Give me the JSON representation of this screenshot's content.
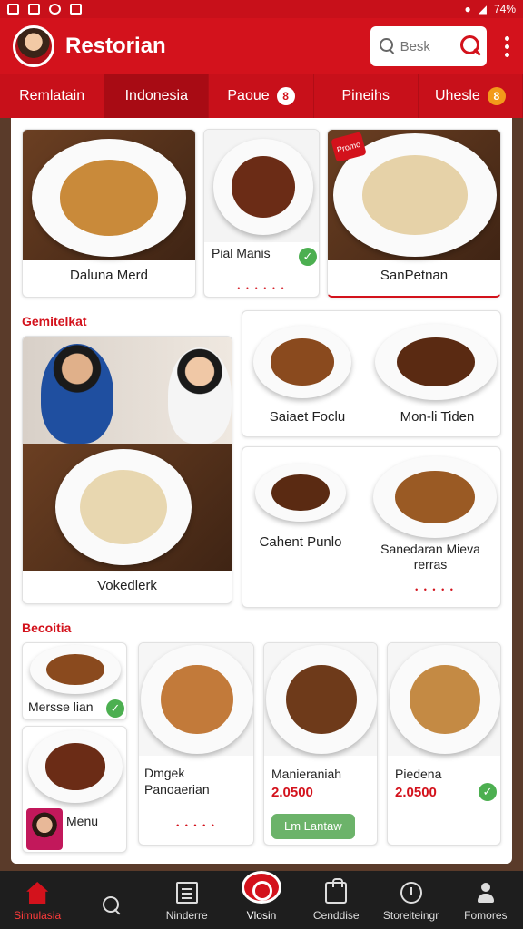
{
  "status_bar": {
    "battery": "74%"
  },
  "header": {
    "title": "Restorian",
    "search_placeholder": "Besk"
  },
  "tabs": [
    {
      "label": "Remlatain",
      "badge": ""
    },
    {
      "label": "Indonesia",
      "badge": ""
    },
    {
      "label": "Paoue",
      "badge": "8"
    },
    {
      "label": "Pineihs",
      "badge": ""
    },
    {
      "label": "Uhesle",
      "badge": "8"
    }
  ],
  "top_cards": [
    {
      "label": "Daluna Merd"
    },
    {
      "label": "Pial Manis"
    },
    {
      "label": "SanPetnan",
      "tag": "Promo"
    }
  ],
  "section1": {
    "title": "Gemitelkat",
    "feature_label": "Vokedlerk",
    "grid": [
      {
        "label": "Saiaet Foclu"
      },
      {
        "label": "Mon-li Tiden"
      },
      {
        "label": "Cahent Punlo"
      },
      {
        "label": "Sanedaran Mieva rerras"
      }
    ]
  },
  "section2": {
    "title": "Becoitia",
    "left": [
      {
        "label": "Mersse lian"
      },
      {
        "label": "Menu"
      }
    ],
    "products": [
      {
        "label": "Dmgek Panoaerian",
        "price": ""
      },
      {
        "label": "Manieraniah",
        "price": "2.0500",
        "button": "Lm Lantaw"
      },
      {
        "label": "Piedena",
        "price": "2.0500"
      }
    ]
  },
  "bottom_nav": [
    {
      "label": "Simulasia",
      "icon": "home-icon"
    },
    {
      "label": "",
      "icon": "search-icon"
    },
    {
      "label": "Ninderre",
      "icon": "menu-icon"
    },
    {
      "label": "Vlosin",
      "icon": "search-icon"
    },
    {
      "label": "Cenddise",
      "icon": "bag-icon"
    },
    {
      "label": "Storeiteingr",
      "icon": "clock-icon"
    },
    {
      "label": "Fomores",
      "icon": "user-icon"
    }
  ],
  "colors": {
    "brand_red": "#d3121c",
    "nav_bg": "#1e1e1e",
    "accent_green": "#4caf50"
  }
}
